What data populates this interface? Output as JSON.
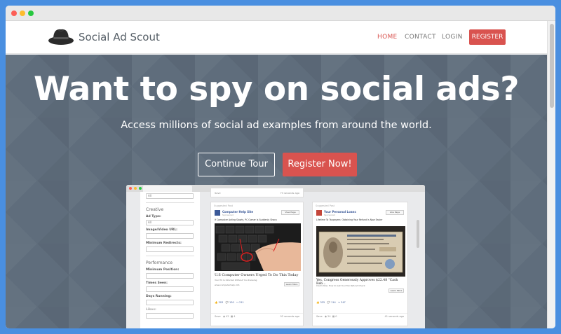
{
  "window": {
    "traffic_lights": [
      "#fc5f57",
      "#fdbc2e",
      "#28c840"
    ]
  },
  "navbar": {
    "brand": "Social Ad Scout",
    "logo_icon": "fedora-hat-icon",
    "links": [
      {
        "label": "HOME",
        "active": true
      },
      {
        "label": "CONTACT",
        "active": false
      },
      {
        "label": "LOGIN",
        "active": false
      }
    ],
    "register_label": "REGISTER"
  },
  "hero": {
    "title": "Want to spy on social ads?",
    "subtitle": "Access millions of social ad examples from around the world.",
    "tour_button": "Continue Tour",
    "register_button": "Register Now!"
  },
  "preview": {
    "filters": {
      "top_select": "All",
      "creative_section": "Creative",
      "ad_type_label": "Ad Type:",
      "ad_type_value": "All",
      "image_url_label": "Image/Video URL:",
      "min_redirects_label": "Minimum Redirects:",
      "performance_section": "Performance",
      "min_position_label": "Minimum Position:",
      "times_seen_label": "Times Seen:",
      "days_running_label": "Days Running:",
      "likes_label": "Likes:"
    },
    "top_strip": {
      "save": "Save",
      "time": "73 seconds ago"
    },
    "cards": [
      {
        "tag": "Suggested Post",
        "page": "Computer Help Site",
        "meta": "Sponsored",
        "view": "View Page",
        "text": "If Computer Acting Slowly, PC Owner Is Suddenly Sharp",
        "headline": "U.S Computer Owners Urged To Do This Today",
        "sub": "Your PC Is Infected Without You Knowing",
        "domain": "www.computerhelp.info",
        "cta": "Learn More",
        "reactions": "303",
        "comments": "130",
        "shares": "211",
        "save": "Save",
        "count_a": "42",
        "count_b": "4",
        "time": "92 seconds ago"
      },
      {
        "tag": "Suggested Post",
        "page": "Your Personal Loans",
        "meta": "Sponsored",
        "view": "Like Page",
        "text": "Lifetime To Taxpayers: Obtaining Your Refund Is Now Easier",
        "headline": "Yes, Congress Generously Approves $22.48 \"Cash Reb...",
        "sub": "Claim Now: How to Get Your Tax Refund Check",
        "domain": "",
        "cta": "Learn More",
        "reactions": "325",
        "comments": "114",
        "shares": "347",
        "save": "Save",
        "count_a": "24",
        "count_b": "0",
        "time": "41 seconds ago"
      }
    ]
  }
}
